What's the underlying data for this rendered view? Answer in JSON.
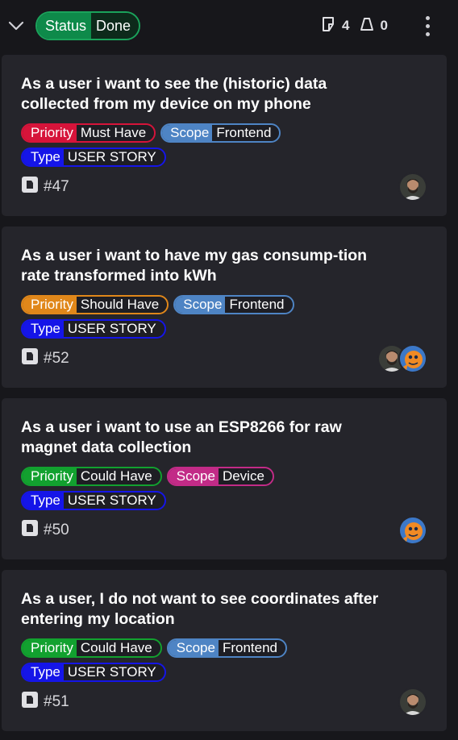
{
  "header": {
    "status_key": "Status",
    "status_value": "Done",
    "issue_count": "4",
    "pr_count": "0"
  },
  "colors": {
    "background": "#17171b",
    "card": "#25252b",
    "priority_must": "#d6143a",
    "priority_should": "#e0871a",
    "priority_could": "#12a12f",
    "scope_frontend": "#4e84c4",
    "scope_device": "#c22b87",
    "type_story": "#1515e8"
  },
  "cards": [
    {
      "title": "As a user i want to see the (historic) data collected from my device on my phone",
      "priority_key": "Priority",
      "priority_value": "Must Have",
      "scope_key": "Scope",
      "scope_value": "Frontend",
      "type_key": "Type",
      "type_value": "USER STORY",
      "number": "#47",
      "avatars": [
        "bearded-user-avatar"
      ]
    },
    {
      "title": "As a user i want to have my gas consump-tion rate transformed into kWh",
      "priority_key": "Priority",
      "priority_value": "Should Have",
      "scope_key": "Scope",
      "scope_value": "Frontend",
      "type_key": "Type",
      "type_value": "USER STORY",
      "number": "#52",
      "avatars": [
        "bearded-user-avatar",
        "orange-cartoon-avatar"
      ]
    },
    {
      "title": "As a user i want to use an ESP8266 for raw magnet data collection",
      "priority_key": "Priority",
      "priority_value": "Could Have",
      "scope_key": "Scope",
      "scope_value": "Device",
      "type_key": "Type",
      "type_value": "USER STORY",
      "number": "#50",
      "avatars": [
        "orange-cartoon-avatar"
      ]
    },
    {
      "title": "As a user, I do not want to see coordinates after entering my location",
      "priority_key": "Priority",
      "priority_value": "Could Have",
      "scope_key": "Scope",
      "scope_value": "Frontend",
      "type_key": "Type",
      "type_value": "USER STORY",
      "number": "#51",
      "avatars": [
        "bearded-user-avatar"
      ]
    }
  ]
}
